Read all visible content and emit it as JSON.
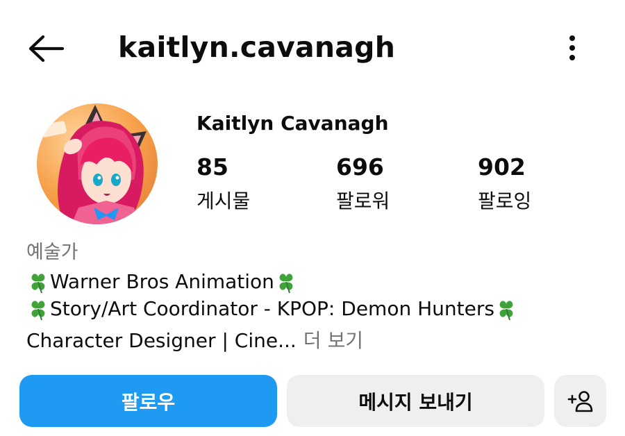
{
  "header": {
    "username": "kaitlyn.cavanagh",
    "back_icon": "arrow-left-icon",
    "more_icon": "more-vertical-icon"
  },
  "profile": {
    "display_name": "Kaitlyn Cavanagh",
    "stats": {
      "posts": {
        "value": "85",
        "label": "게시물"
      },
      "followers": {
        "value": "696",
        "label": "팔로워"
      },
      "following": {
        "value": "902",
        "label": "팔로잉"
      }
    }
  },
  "bio": {
    "category": "예술가",
    "line1": "Warner Bros Animation",
    "line2": "Story/Art Coordinator - KPOP: Demon Hunters",
    "line3": "Character Designer | Cine...",
    "more_label": "더 보기",
    "emoji_icon": "four-leaf-clover-icon"
  },
  "actions": {
    "follow_label": "팔로우",
    "message_label": "메시지 보내기",
    "add_user_icon": "add-user-icon"
  },
  "colors": {
    "primary_button": "#1f9af2",
    "secondary_button": "#efefef",
    "muted_text": "#737373",
    "text": "#0c0c0c",
    "clover": "#3fa33a"
  }
}
